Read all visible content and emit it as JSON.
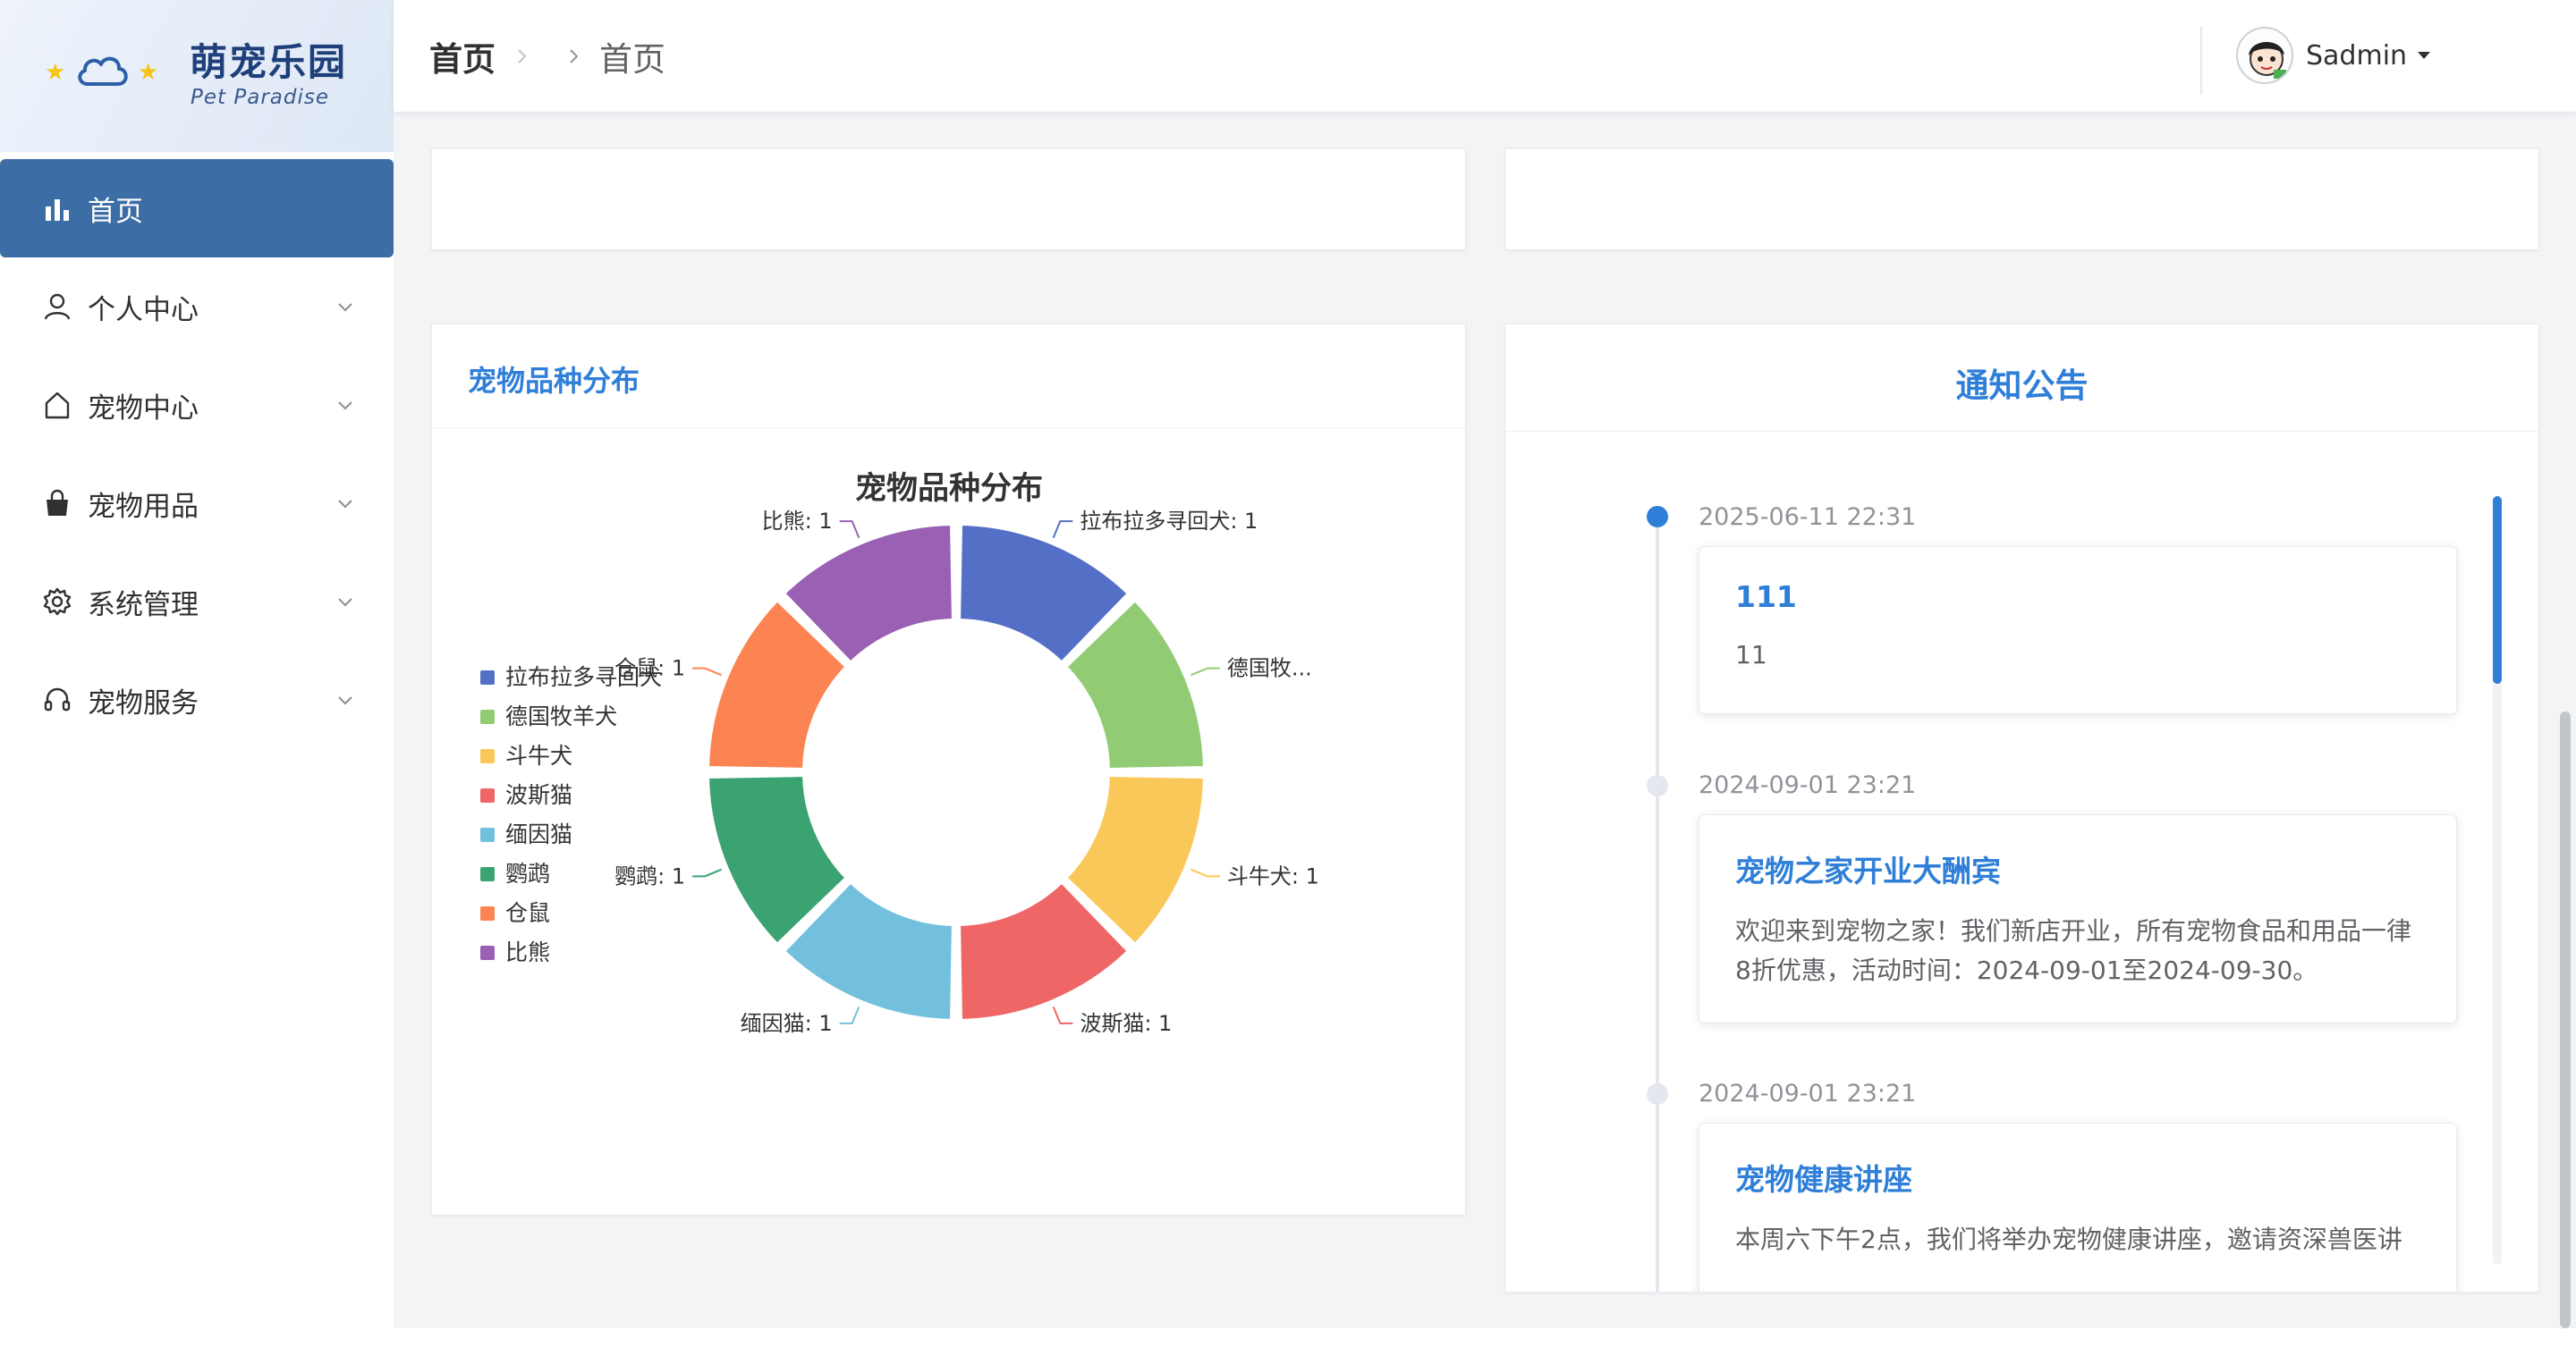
{
  "app": {
    "title": "萌宠乐园",
    "subtitle": "Pet Paradise"
  },
  "sidebar": {
    "items": [
      {
        "label": "首页",
        "icon": "bar-chart-icon",
        "active": true
      },
      {
        "label": "个人中心",
        "icon": "user-icon",
        "expandable": true
      },
      {
        "label": "宠物中心",
        "icon": "home-icon",
        "expandable": true
      },
      {
        "label": "宠物用品",
        "icon": "shopping-bag-icon",
        "expandable": true
      },
      {
        "label": "系统管理",
        "icon": "gear-icon",
        "expandable": true
      },
      {
        "label": "宠物服务",
        "icon": "headset-icon",
        "expandable": true
      }
    ]
  },
  "header": {
    "breadcrumb": [
      "首页",
      "首页"
    ],
    "username": "Sadmin"
  },
  "chart_card": {
    "header": "宠物品种分布"
  },
  "chart_data": {
    "type": "pie",
    "variant": "donut",
    "title": "宠物品种分布",
    "legend_position": "left",
    "categories": [
      "拉布拉多寻回犬",
      "德国牧羊犬",
      "斗牛犬",
      "波斯猫",
      "缅因猫",
      "鹦鹉",
      "仓鼠",
      "比熊"
    ],
    "values": [
      1,
      1,
      1,
      1,
      1,
      1,
      1,
      1
    ],
    "slice_labels": [
      "拉布拉多寻回犬: 1",
      "德国牧...",
      "斗牛犬: 1",
      "波斯猫: 1",
      "缅因猫: 1",
      "鹦鹉: 1",
      "仓鼠: 1",
      "比熊: 1"
    ],
    "colors": [
      "#5470c6",
      "#91cc75",
      "#fac858",
      "#ee6666",
      "#73c0de",
      "#3ba272",
      "#fc8452",
      "#9a60b4"
    ]
  },
  "notice_card": {
    "header": "通知公告",
    "items": [
      {
        "time": "2025-06-11 22:31",
        "title": "111",
        "body": "11"
      },
      {
        "time": "2024-09-01 23:21",
        "title": "宠物之家开业大酬宾",
        "body": "欢迎来到宠物之家！我们新店开业，所有宠物食品和用品一律8折优惠，活动时间：2024-09-01至2024-09-30。"
      },
      {
        "time": "2024-09-01 23:21",
        "title": "宠物健康讲座",
        "body": "本周六下午2点，我们将举办宠物健康讲座，邀请资深兽医讲"
      }
    ]
  },
  "colors": {
    "accent": "#2f7fd8",
    "sidebar_active": "#3c6da5"
  }
}
